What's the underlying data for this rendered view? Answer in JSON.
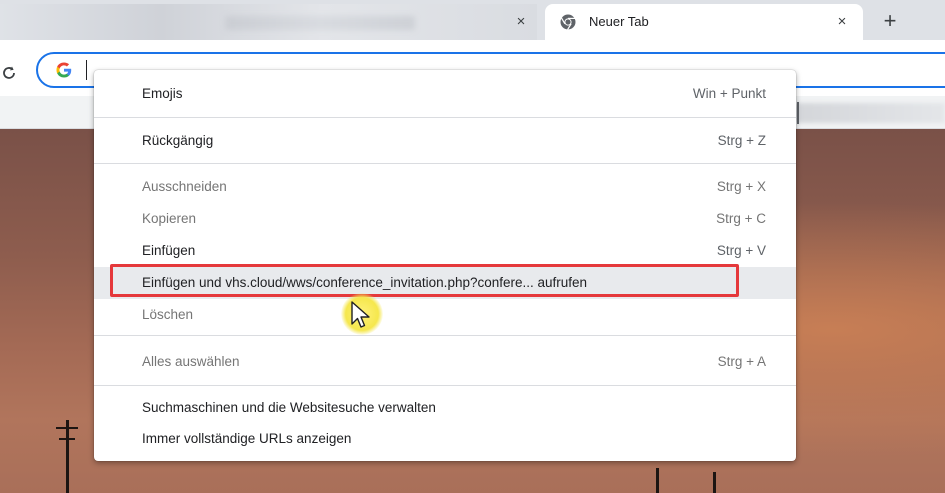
{
  "browser": {
    "active_tab_title": "Neuer Tab",
    "new_tab_glyph": "+",
    "close_glyph": "×"
  },
  "omnibox": {
    "value": ""
  },
  "context_menu": {
    "items": [
      {
        "label": "Emojis",
        "shortcut": "Win + Punkt",
        "enabled": true
      },
      {
        "label": "Rückgängig",
        "shortcut": "Strg + Z",
        "enabled": true
      },
      {
        "label": "Ausschneiden",
        "shortcut": "Strg + X",
        "enabled": false
      },
      {
        "label": "Kopieren",
        "shortcut": "Strg + C",
        "enabled": false
      },
      {
        "label": "Einfügen",
        "shortcut": "Strg + V",
        "enabled": true
      },
      {
        "label": "Einfügen und vhs.cloud/wws/conference_invitation.php?confere... aufrufen",
        "shortcut": "",
        "enabled": true,
        "hovered": true,
        "highlighted": true
      },
      {
        "label": "Löschen",
        "shortcut": "",
        "enabled": false
      },
      {
        "label": "Alles auswählen",
        "shortcut": "Strg + A",
        "enabled": false
      },
      {
        "label": "Suchmaschinen und die Websitesuche verwalten",
        "shortcut": "",
        "enabled": true
      },
      {
        "label": "Immer vollständige URLs anzeigen",
        "shortcut": "",
        "enabled": true
      }
    ]
  },
  "colors": {
    "omnibox_border": "#1a73e8",
    "highlight_border": "#e5383b",
    "cursor_halo": "#f5e74d"
  },
  "icons": [
    "chrome-favicon-icon",
    "close-icon",
    "new-tab-icon",
    "reload-icon",
    "google-g-icon",
    "mouse-cursor-icon"
  ]
}
